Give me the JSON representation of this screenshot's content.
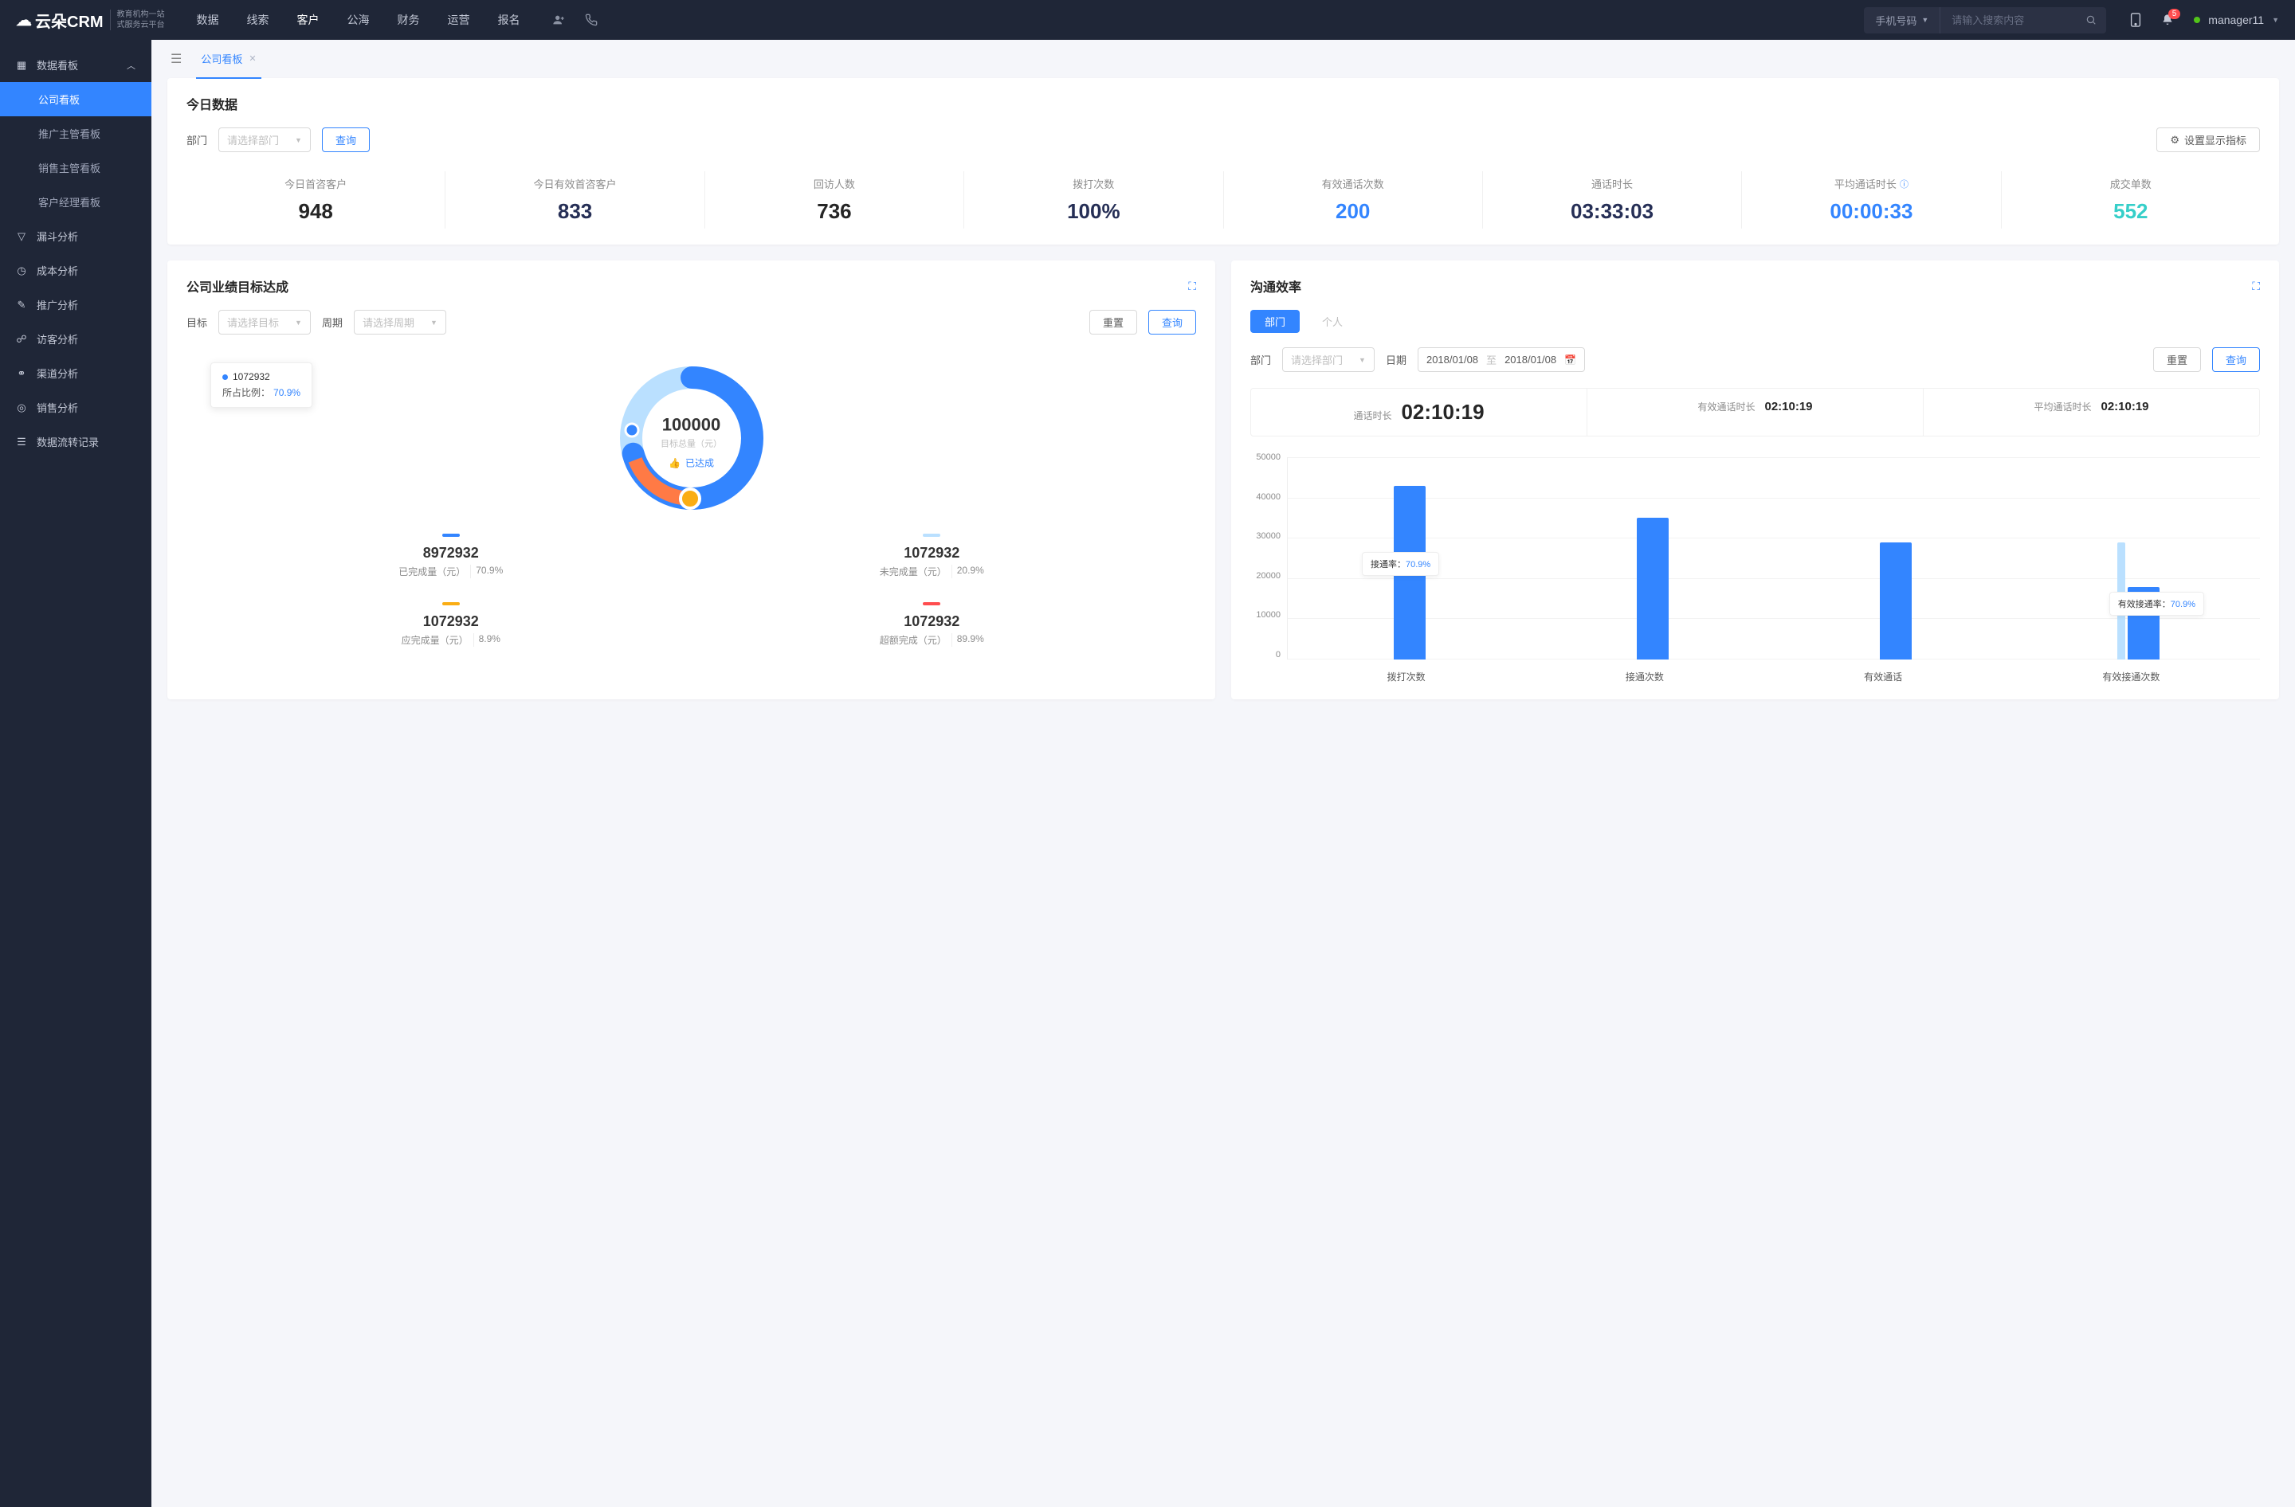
{
  "header": {
    "logo_main": "云朵CRM",
    "logo_sub_1": "教育机构一站",
    "logo_sub_2": "式服务云平台",
    "nav": [
      "数据",
      "线索",
      "客户",
      "公海",
      "财务",
      "运营",
      "报名"
    ],
    "nav_active": 2,
    "search_type": "手机号码",
    "search_placeholder": "请输入搜索内容",
    "notif_count": "5",
    "username": "manager11"
  },
  "sidebar": {
    "group1_label": "数据看板",
    "group1_items": [
      "公司看板",
      "推广主管看板",
      "销售主管看板",
      "客户经理看板"
    ],
    "group1_active": 0,
    "rest": [
      {
        "icon": "funnel",
        "label": "漏斗分析"
      },
      {
        "icon": "clock",
        "label": "成本分析"
      },
      {
        "icon": "chart",
        "label": "推广分析"
      },
      {
        "icon": "visitor",
        "label": "访客分析"
      },
      {
        "icon": "channel",
        "label": "渠道分析"
      },
      {
        "icon": "circle",
        "label": "销售分析"
      },
      {
        "icon": "list",
        "label": "数据流转记录"
      }
    ]
  },
  "tab": {
    "label": "公司看板"
  },
  "today": {
    "title": "今日数据",
    "dept_label": "部门",
    "dept_placeholder": "请选择部门",
    "query_btn": "查询",
    "settings_btn": "设置显示指标",
    "stats": [
      {
        "label": "今日首咨客户",
        "value": "948",
        "cls": "c-dark"
      },
      {
        "label": "今日有效首咨客户",
        "value": "833",
        "cls": "c-navy"
      },
      {
        "label": "回访人数",
        "value": "736",
        "cls": "c-dark"
      },
      {
        "label": "拨打次数",
        "value": "100%",
        "cls": "c-navy"
      },
      {
        "label": "有效通话次数",
        "value": "200",
        "cls": "c-blue"
      },
      {
        "label": "通话时长",
        "value": "03:33:03",
        "cls": "c-navy"
      },
      {
        "label": "平均通话时长",
        "value": "00:00:33",
        "cls": "c-blue",
        "info": true
      },
      {
        "label": "成交单数",
        "value": "552",
        "cls": "c-cyan"
      }
    ]
  },
  "target": {
    "title": "公司业绩目标达成",
    "goal_label": "目标",
    "goal_placeholder": "请选择目标",
    "period_label": "周期",
    "period_placeholder": "请选择周期",
    "reset_btn": "重置",
    "query_btn": "查询",
    "tooltip_value": "1072932",
    "tooltip_ratio_label": "所占比例：",
    "tooltip_ratio": "70.9%",
    "center_value": "100000",
    "center_sub": "目标总量（元）",
    "center_tag": "已达成",
    "legend": [
      {
        "bar": "b-blue",
        "value": "8972932",
        "label": "已完成量（元）",
        "pct": "70.9%"
      },
      {
        "bar": "b-sky",
        "value": "1072932",
        "label": "未完成量（元）",
        "pct": "20.9%"
      },
      {
        "bar": "b-orn",
        "value": "1072932",
        "label": "应完成量（元）",
        "pct": "8.9%"
      },
      {
        "bar": "b-red",
        "value": "1072932",
        "label": "超额完成（元）",
        "pct": "89.9%"
      }
    ]
  },
  "efficiency": {
    "title": "沟通效率",
    "seg": [
      "部门",
      "个人"
    ],
    "seg_active": 0,
    "dept_label": "部门",
    "dept_placeholder": "请选择部门",
    "date_label": "日期",
    "date_from": "2018/01/08",
    "date_to": "2018/01/08",
    "date_sep": "至",
    "reset_btn": "重置",
    "query_btn": "查询",
    "times": [
      {
        "label": "通话时长",
        "value": "02:10:19",
        "big": true
      },
      {
        "label": "有效通话时长",
        "value": "02:10:19"
      },
      {
        "label": "平均通话时长",
        "value": "02:10:19"
      }
    ],
    "float1_label": "接通率：",
    "float1_val": "70.9%",
    "float2_label": "有效接通率：",
    "float2_val": "70.9%"
  },
  "chart_data": {
    "type": "bar",
    "ylim": [
      0,
      50000
    ],
    "yticks": [
      "50000",
      "40000",
      "30000",
      "20000",
      "10000",
      "0"
    ],
    "categories": [
      "拨打次数",
      "接通次数",
      "有效通话",
      "有效接通次数"
    ],
    "series": [
      {
        "name": "main",
        "values": [
          43000,
          35000,
          29000,
          18000
        ]
      },
      {
        "name": "sub",
        "values": [
          null,
          null,
          null,
          29000
        ]
      }
    ],
    "labels": [
      "43000",
      "35000",
      "29000",
      "18000"
    ]
  }
}
